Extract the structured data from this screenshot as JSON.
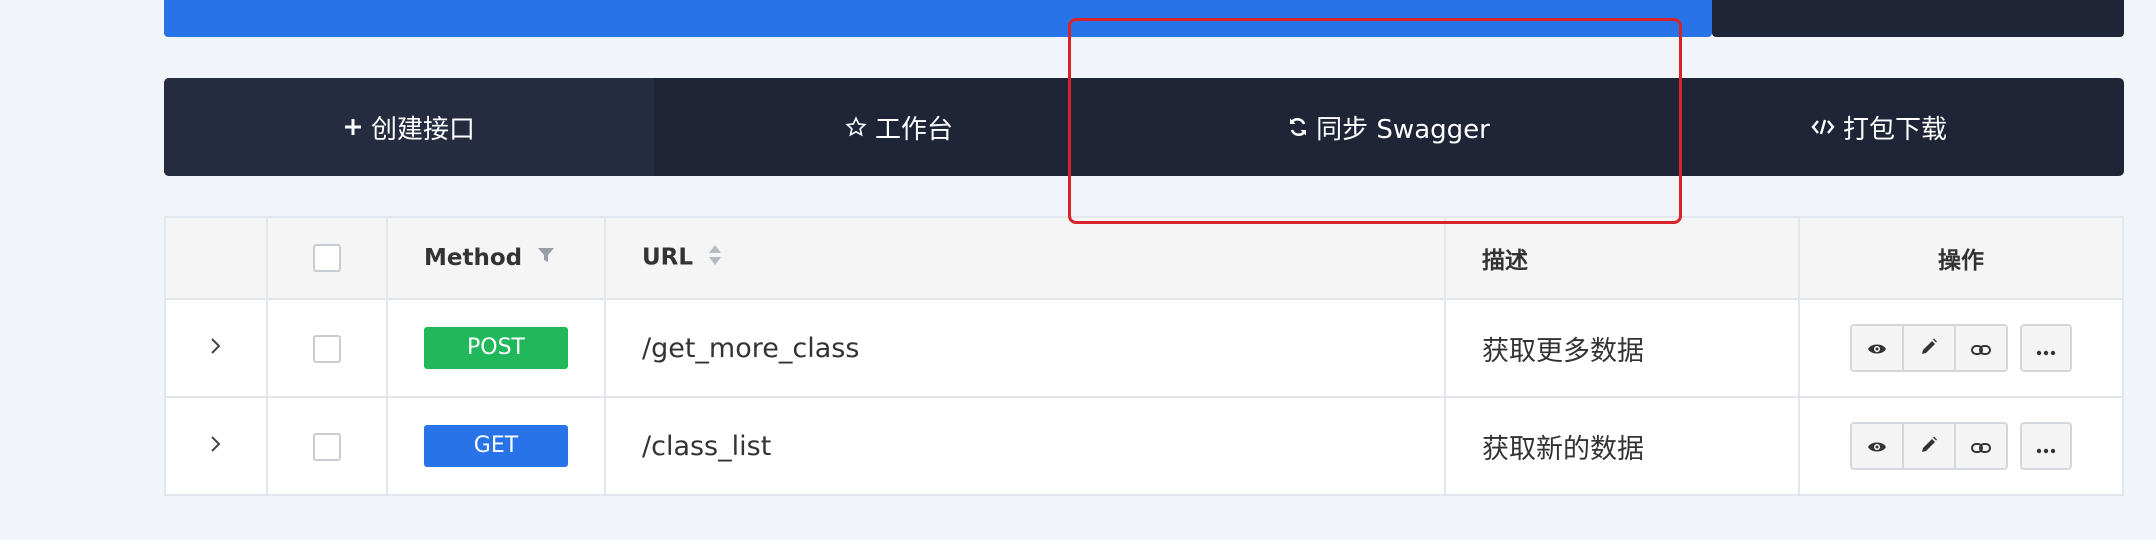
{
  "toolbar": {
    "create_label": "创建接口",
    "workbench_label": "工作台",
    "sync_label": "同步 Swagger",
    "download_label": "打包下载"
  },
  "table": {
    "headers": {
      "method": "Method",
      "url": "URL",
      "description": "描述",
      "actions": "操作"
    },
    "rows": [
      {
        "method": "POST",
        "method_color": "#21b85c",
        "url": "/get_more_class",
        "description": "获取更多数据"
      },
      {
        "method": "GET",
        "method_color": "#2873e8",
        "url": "/class_list",
        "description": "获取新的数据"
      }
    ]
  },
  "colors": {
    "accent_blue": "#2873e8",
    "dark_bar": "#1f2437",
    "highlight_red": "#d8232a",
    "post_green": "#21b85c"
  },
  "icons": {
    "create": "plus-icon",
    "workbench": "star-icon",
    "sync": "sync-icon",
    "download": "code-icon",
    "method_filter": "filter-icon",
    "url_sort": "sort-icon",
    "row_expand": "chevron-right-icon",
    "view": "eye-icon",
    "edit": "pencil-icon",
    "link": "link-icon",
    "more": "ellipsis-icon"
  }
}
